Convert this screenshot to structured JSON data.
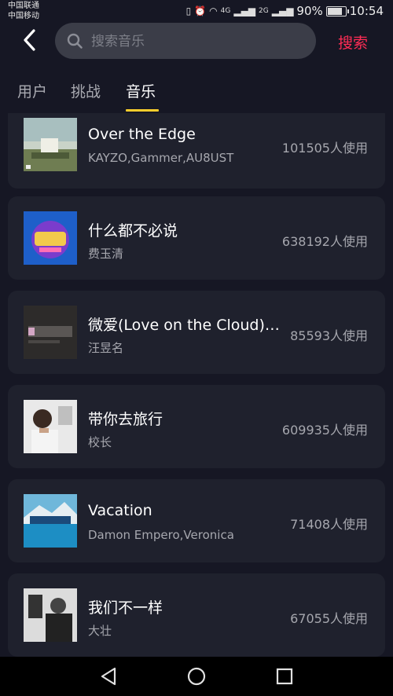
{
  "status_bar": {
    "carrier1": "中国联通",
    "carrier2": "中国移动",
    "net1": "4G",
    "net2": "2G",
    "battery_text": "90%",
    "time": "10:54"
  },
  "header": {
    "search_placeholder": "搜索音乐",
    "search_button": "搜索"
  },
  "tabs": [
    {
      "label": "用户",
      "active": false
    },
    {
      "label": "挑战",
      "active": false
    },
    {
      "label": "音乐",
      "active": true
    }
  ],
  "songs": [
    {
      "title": "Over the Edge",
      "artist": "KAYZO,Gammer,AU8UST",
      "count": "101505人使用"
    },
    {
      "title": "什么都不必说",
      "artist": "费玉清",
      "count": "638192人使用"
    },
    {
      "title": "微爱(Love on the Cloud)(...",
      "artist": "汪昱名",
      "count": "85593人使用"
    },
    {
      "title": "带你去旅行",
      "artist": "校长",
      "count": "609935人使用"
    },
    {
      "title": "Vacation",
      "artist": "Damon Empero,Veronica",
      "count": "71408人使用"
    },
    {
      "title": "我们不一样",
      "artist": "大壮",
      "count": "67055人使用"
    }
  ],
  "colors": {
    "accent": "#fe2c55",
    "tab_underline": "#facd2c",
    "background": "#161724",
    "card": "#1f212d"
  }
}
